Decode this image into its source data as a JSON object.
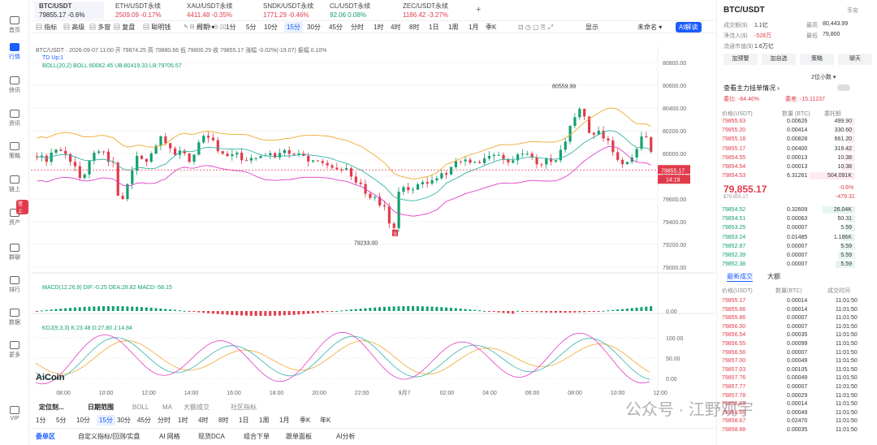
{
  "sidebar": [
    {
      "label": "首页",
      "icon": "home-icon"
    },
    {
      "label": "行情",
      "icon": "chart-bar-icon"
    },
    {
      "label": "快讯",
      "icon": "news-icon"
    },
    {
      "label": "资讯",
      "icon": "doc-icon"
    },
    {
      "label": "策略",
      "icon": "strategy-icon"
    },
    {
      "label": "链上",
      "icon": "chain-icon"
    },
    {
      "label": "资产",
      "icon": "wallet-icon"
    },
    {
      "label": "群聊",
      "icon": "chat-icon"
    },
    {
      "label": "排行",
      "icon": "rank-icon"
    },
    {
      "label": "数据",
      "icon": "data-icon"
    },
    {
      "label": "更多",
      "icon": "more-icon"
    },
    {
      "label": "VIP",
      "icon": "vip-icon"
    }
  ],
  "sidebar_badge": "登上",
  "tabs": [
    {
      "name": "BTC/USDT",
      "price": "79855.17",
      "chg": "-0.6%"
    },
    {
      "name": "ETH/USDT永续",
      "price": "2509.09",
      "chg": "-0.17%"
    },
    {
      "name": "XAU/USDT永续",
      "price": "4411.48",
      "chg": "-0.35%"
    },
    {
      "name": "SNDK/USDT永续",
      "price": "1771.29",
      "chg": "-0.46%"
    },
    {
      "name": "CL/USDT永续",
      "price": "92.06",
      "chg": "0.08%"
    },
    {
      "name": "ZEC/USDT永续",
      "price": "1186.42",
      "chg": "-3.27%"
    }
  ],
  "toolbar": {
    "left": [
      "指标",
      "高级",
      "多窗",
      "复盘",
      "聪明钱"
    ],
    "period_label": "周期",
    "periods": [
      "1分",
      "5分",
      "10分",
      "15分",
      "30分",
      "45分",
      "分时",
      "1时",
      "4时",
      "8时",
      "1日",
      "1周",
      "1月",
      "季K"
    ],
    "selected_period": "15分",
    "display": "显示",
    "unnamed": "未命名",
    "ai": "AI解读"
  },
  "chart": {
    "info": "BTC/USDT · 2026-09-07 11:00 开 79874.25 高 79880.66 低 79800.29 收 79855.17 涨幅 -0.02%(-19.07) 振幅 0.10%",
    "td": "TD Up:1",
    "boll": "BOLL(20,2)  BOLL:80062.45  UB:80419.33  LB:79705.57",
    "macd": "MACD(12,26,9)  DIF:-0.25  DEA:28.82  MACD:-58.15",
    "kdj": "KDJ(9,3,3)  K:23.48  D:27.80  J:14.84",
    "price_ticks": [
      "80800.00",
      "80600.00",
      "80400.00",
      "80200.00",
      "80000.00",
      "79800.00",
      "79600.00",
      "79400.00",
      "79200.00",
      "79000.00"
    ],
    "macd_tick": "0.00",
    "kdj_ticks": [
      "100.00",
      "50.00",
      "0.00"
    ],
    "time_ticks": [
      "08:00",
      "10:00",
      "12:00",
      "14:00",
      "16:00",
      "18:00",
      "20:00",
      "22:00",
      "9月7",
      "02:00",
      "04:00",
      "06:00",
      "08:00",
      "10:00",
      "12:00"
    ],
    "high_label": "80559.99",
    "low_label": "79233.00",
    "last_price": "79855.17",
    "countdown": "14:19",
    "logo": "AiCoin",
    "marker": "9"
  },
  "bottom": {
    "row1": [
      "定位刻...",
      "日期范围",
      "BOLL",
      "MA",
      "大额成交",
      "社区指标"
    ],
    "periods": [
      "1分",
      "5分",
      "10分",
      "15分",
      "30分",
      "45分",
      "分时",
      "1时",
      "4时",
      "8时",
      "1日",
      "1周",
      "1月",
      "季K",
      "年K"
    ],
    "selected": "15分",
    "tabs": [
      "委单区",
      "自定义指标/回测/实盘",
      "AI 网格",
      "现货DCA",
      "组合下单",
      "跟单面板",
      "AI分析"
    ]
  },
  "right": {
    "symbol": "BTC/USDT",
    "currency": "币安",
    "stats": [
      [
        "成交额($)",
        "1.1亿",
        "最高",
        "80,443.99"
      ],
      [
        "净流入($)",
        "-528万",
        "最低",
        "79,800"
      ],
      [
        "流通市值($)",
        "1.6万亿",
        "",
        ""
      ]
    ],
    "buttons": [
      "加预警",
      "加自选",
      "策略",
      "聊天"
    ],
    "depth_label": "2位小数",
    "main_force": "查看主力挂单情况",
    "ratio_label1": "委比:",
    "ratio1": "-84.46%",
    "ratio_label2": "委差:",
    "ratio2": "-15.11237",
    "headers": [
      "价格(USDT)",
      "数量 (BTC)",
      "委托额"
    ],
    "asks": [
      [
        "79855.63",
        "0.00626",
        "499.90"
      ],
      [
        "79855.20",
        "0.00414",
        "330.60"
      ],
      [
        "79855.18",
        "0.00828",
        "661.20"
      ],
      [
        "79855.17",
        "0.00400",
        "319.42"
      ],
      [
        "79854.55",
        "0.00013",
        "10.38"
      ],
      [
        "79854.54",
        "0.00013",
        "10.38"
      ],
      [
        "79854.53",
        "6.31261",
        "504.091K"
      ]
    ],
    "last": "79,855.17",
    "last_sub": "$79,855.17",
    "last_chg": "-0.6%",
    "last_diff": "-479.31",
    "bids": [
      [
        "79854.52",
        "0.32609",
        "26.04K"
      ],
      [
        "79854.51",
        "0.00063",
        "50.31"
      ],
      [
        "79853.25",
        "0.00007",
        "5.59"
      ],
      [
        "79853.24",
        "0.01485",
        "1.186K"
      ],
      [
        "79852.87",
        "0.00007",
        "5.59"
      ],
      [
        "79852.39",
        "0.00007",
        "5.59"
      ],
      [
        "79852.38",
        "0.00007",
        "5.59"
      ]
    ],
    "trades_tab": "最新成交",
    "big_tab": "大额",
    "trade_headers": [
      "价格(USDT)",
      "数量(BTC)",
      "成交时间"
    ],
    "trades": [
      [
        "79855.17",
        "0.00014",
        "11:01:50"
      ],
      [
        "79855.66",
        "0.00014",
        "11:01:50"
      ],
      [
        "79855.86",
        "0.00007",
        "11:01:50"
      ],
      [
        "79856.00",
        "0.00007",
        "11:01:50"
      ],
      [
        "79856.54",
        "0.00035",
        "11:01:50"
      ],
      [
        "79856.55",
        "0.00099",
        "11:01:50"
      ],
      [
        "79856.56",
        "0.00007",
        "11:01:50"
      ],
      [
        "79857.00",
        "0.00049",
        "11:01:50"
      ],
      [
        "79857.03",
        "0.00105",
        "11:01:50"
      ],
      [
        "79857.76",
        "0.00049",
        "11:01:50"
      ],
      [
        "79857.77",
        "0.00007",
        "11:01:50"
      ],
      [
        "79857.78",
        "0.00029",
        "11:01:50"
      ],
      [
        "79858.65",
        "0.00014",
        "11:01:50"
      ],
      [
        "79858.66",
        "0.00049",
        "11:01:50"
      ],
      [
        "79858.67",
        "0.02470",
        "11:01:50"
      ],
      [
        "79858.68",
        "0.00035",
        "11:01:50"
      ]
    ],
    "watermark": "公众号 · 江野观宇"
  },
  "colors": {
    "up": "#12a06c",
    "down": "#e13b4b",
    "boll_mid": "#36b4a8",
    "boll_ub": "#f0a830",
    "boll_lb": "#e040c8",
    "accent": "#1a5cff"
  }
}
